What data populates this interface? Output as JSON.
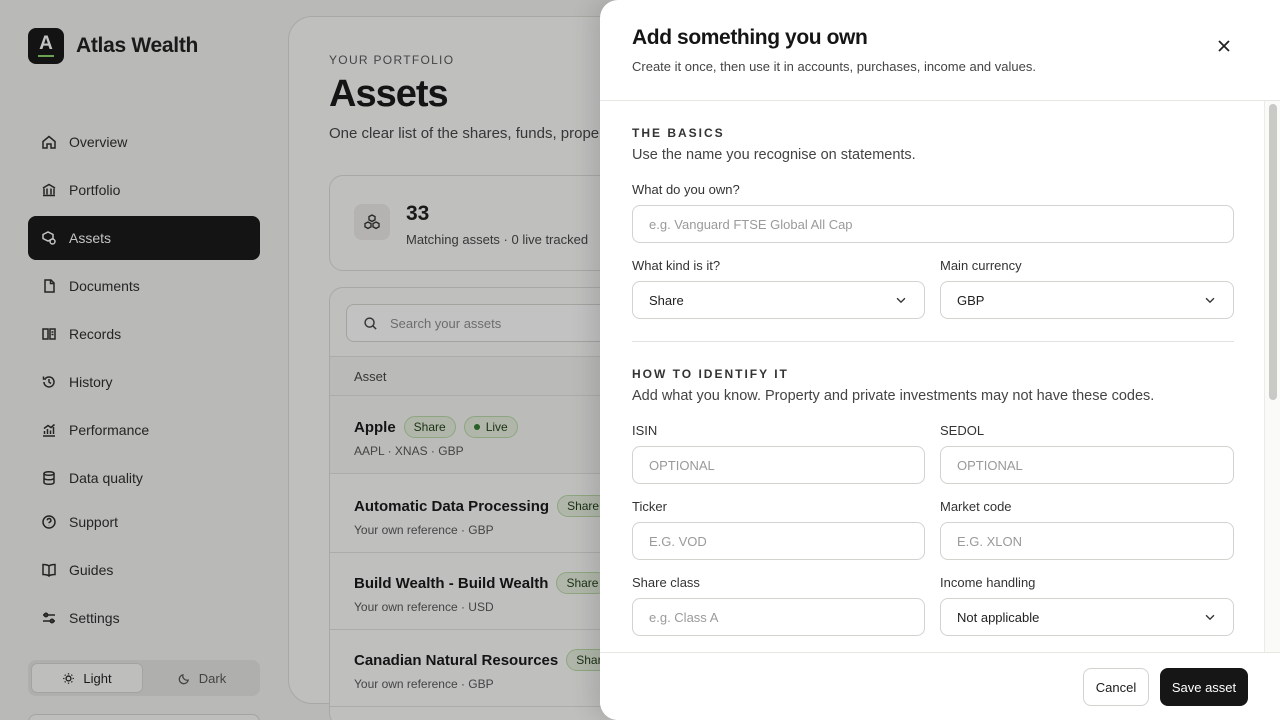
{
  "brand": {
    "name": "Atlas Wealth",
    "logo_letter": "A",
    "accent": "#8bd46a"
  },
  "nav": {
    "items": [
      {
        "label": "Overview",
        "icon": "home-icon"
      },
      {
        "label": "Portfolio",
        "icon": "bank-icon"
      },
      {
        "label": "Assets",
        "icon": "assets-icon",
        "active": true
      },
      {
        "label": "Documents",
        "icon": "document-icon"
      },
      {
        "label": "Records",
        "icon": "records-icon"
      },
      {
        "label": "History",
        "icon": "history-icon"
      },
      {
        "label": "Performance",
        "icon": "chart-icon"
      },
      {
        "label": "Data quality",
        "icon": "database-icon"
      },
      {
        "label": "Support",
        "icon": "help-icon"
      },
      {
        "label": "Guides",
        "icon": "book-icon"
      },
      {
        "label": "Settings",
        "icon": "sliders-icon"
      }
    ]
  },
  "theme_toggle": {
    "light": "Light",
    "dark": "Dark",
    "selected": "Light"
  },
  "page": {
    "eyebrow": "YOUR PORTFOLIO",
    "title": "Assets",
    "subtitle": "One clear list of the shares, funds, property"
  },
  "stats": {
    "count": "33",
    "label": "Matching assets · 0 live tracked"
  },
  "table": {
    "search_placeholder": "Search your assets",
    "column_asset": "Asset",
    "rows": [
      {
        "name": "Apple",
        "badges": [
          "Share",
          "Live"
        ],
        "meta": "AAPL · XNAS · GBP"
      },
      {
        "name": "Automatic Data Processing",
        "badges": [
          "Share"
        ],
        "meta": "Your own reference · GBP"
      },
      {
        "name": "Build Wealth - Build Wealth",
        "badges": [
          "Share"
        ],
        "meta": "Your own reference · USD"
      },
      {
        "name": "Canadian Natural Resources",
        "badges": [
          "Share"
        ],
        "meta": "Your own reference · GBP"
      }
    ]
  },
  "drawer": {
    "title": "Add something you own",
    "subtitle": "Create it once, then use it in accounts, purchases, income and values.",
    "basics": {
      "eyebrow": "THE BASICS",
      "description": "Use the name you recognise on statements.",
      "name_label": "What do you own?",
      "name_value": "",
      "name_placeholder": "e.g. Vanguard FTSE Global All Cap",
      "kind_label": "What kind is it?",
      "kind_value": "Share",
      "currency_label": "Main currency",
      "currency_value": "GBP"
    },
    "identify": {
      "eyebrow": "HOW TO IDENTIFY IT",
      "description": "Add what you know. Property and private investments may not have these codes.",
      "isin_label": "ISIN",
      "isin_placeholder": "OPTIONAL",
      "sedol_label": "SEDOL",
      "sedol_placeholder": "OPTIONAL",
      "ticker_label": "Ticker",
      "ticker_placeholder": "E.G. VOD",
      "market_label": "Market code",
      "market_placeholder": "E.G. XLON",
      "share_class_label": "Share class",
      "share_class_placeholder": "e.g. Class A",
      "income_label": "Income handling",
      "income_value": "Not applicable"
    },
    "cancel_label": "Cancel",
    "save_label": "Save asset"
  }
}
